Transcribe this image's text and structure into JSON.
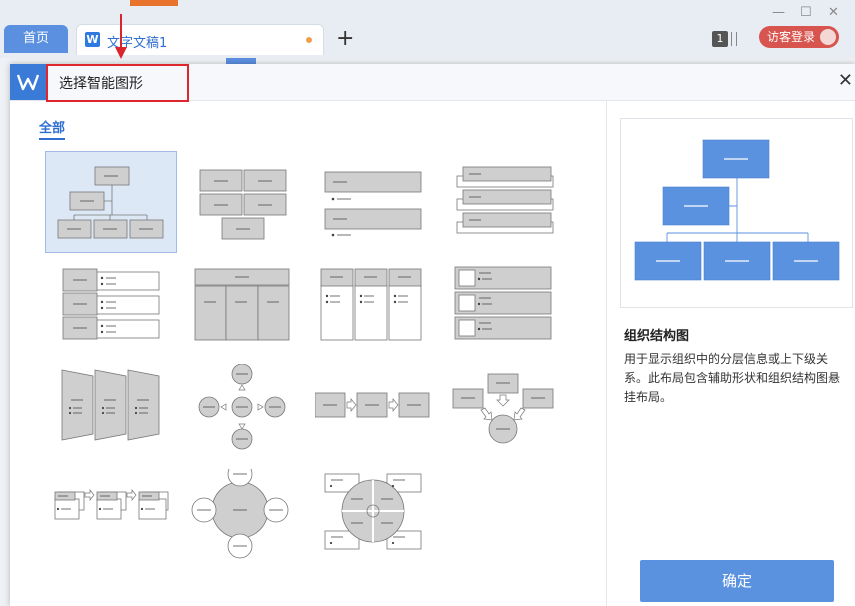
{
  "browser": {
    "home_tab": "首页",
    "doc_tab": "文字文稿1",
    "new_tab": "+",
    "page_count": "1",
    "login": "访客登录",
    "minimize": "—",
    "maximize": "☐",
    "close": "✕"
  },
  "dialog": {
    "title": "选择智能图形",
    "close": "✕",
    "category": "全部",
    "selected": {
      "title": "组织结构图",
      "description": "用于显示组织中的分层信息或上下级关系。此布局包含辅助形状和组织结构图悬挂布局。"
    },
    "ok_button": "确定"
  },
  "colors": {
    "accent": "#2e6fd0",
    "preview_box": "#5b92e0",
    "selected_bg": "#dde8f6",
    "annotation": "#e0262d"
  }
}
